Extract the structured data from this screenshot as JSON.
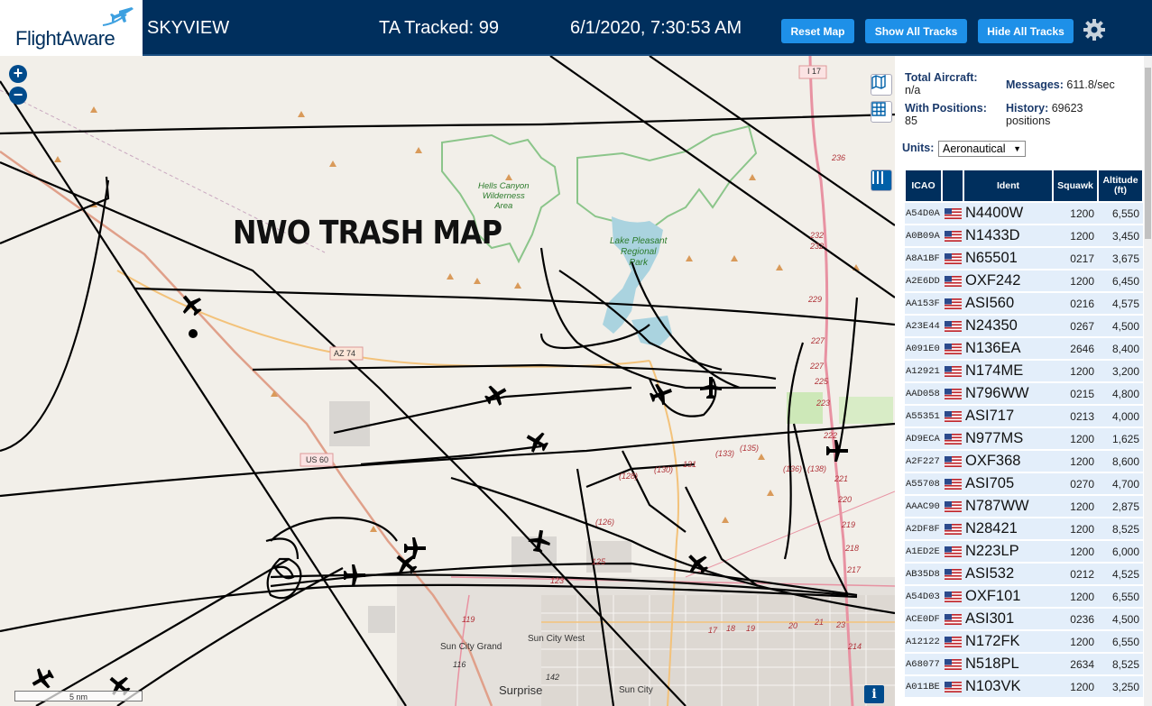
{
  "header": {
    "logo": "FlightAware",
    "app_name": "SKYVIEW",
    "tracked": "TA Tracked: 99",
    "datetime": "6/1/2020, 7:30:53 AM",
    "reset_label": "Reset Map",
    "show_label": "Show All Tracks",
    "hide_label": "Hide All Tracks",
    "settings_icon": "gear-icon"
  },
  "map": {
    "overlay_title": "NWO TRASH MAP",
    "scale": "5 nm",
    "info": "i",
    "labels": {
      "hells_canyon": [
        "Hells Canyon",
        "Wilderness",
        "Area"
      ],
      "lake_pleasant": [
        "Lake Pleasant",
        "Regional",
        "Park"
      ],
      "i17": "I 17",
      "az74": "AZ 74",
      "us60": "US 60",
      "sun_city_grand": "Sun City Grand",
      "sun_city_west": "Sun City West",
      "surprise": "Surprise",
      "sun_city": "Sun City",
      "r128": "(128)",
      "r130": "(130)",
      "r131": "131",
      "r133": "(133)",
      "r135": "(135)",
      "r136": "(136)",
      "r138": "(138)",
      "r126": "(126)",
      "r125": "125",
      "r123": "123",
      "r119": "119",
      "r116": "116",
      "r142": "142",
      "r236": "236",
      "r232a": "232",
      "r232b": "232",
      "r229": "229",
      "r227a": "227",
      "r227b": "227",
      "r225": "225",
      "r223": "223",
      "r222": "222",
      "r221": "221",
      "r220": "220",
      "r219": "219",
      "r218": "218",
      "r217": "217",
      "r214": "214",
      "r17": "17",
      "r18": "18",
      "r19": "19",
      "r20": "20",
      "r21": "21",
      "r23": "23"
    }
  },
  "stats": {
    "total_label": "Total Aircraft:",
    "total_value": "n/a",
    "messages_label": "Messages:",
    "messages_value": "611.8/sec",
    "positions_label": "With Positions:",
    "positions_value": "85",
    "history_label": "History:",
    "history_value": "69623",
    "history_unit": "positions",
    "units_label": "Units:",
    "units_value": "Aeronautical"
  },
  "table": {
    "headers": {
      "icao": "ICAO",
      "ident": "Ident",
      "squawk": "Squawk",
      "alt1": "Altitude",
      "alt2": "(ft)"
    },
    "rows": [
      {
        "icao": "A54D0A",
        "ident": "N4400W",
        "squawk": "1200",
        "alt": "6,550"
      },
      {
        "icao": "A0B09A",
        "ident": "N1433D",
        "squawk": "1200",
        "alt": "3,450"
      },
      {
        "icao": "A8A1BF",
        "ident": "N65501",
        "squawk": "0217",
        "alt": "3,675"
      },
      {
        "icao": "A2E6DD",
        "ident": "OXF242",
        "squawk": "1200",
        "alt": "6,450"
      },
      {
        "icao": "AA153F",
        "ident": "ASI560",
        "squawk": "0216",
        "alt": "4,575"
      },
      {
        "icao": "A23E44",
        "ident": "N24350",
        "squawk": "0267",
        "alt": "4,500"
      },
      {
        "icao": "A091E0",
        "ident": "N136EA",
        "squawk": "2646",
        "alt": "8,400"
      },
      {
        "icao": "A12921",
        "ident": "N174ME",
        "squawk": "1200",
        "alt": "3,200"
      },
      {
        "icao": "AAD058",
        "ident": "N796WW",
        "squawk": "0215",
        "alt": "4,800"
      },
      {
        "icao": "A55351",
        "ident": "ASI717",
        "squawk": "0213",
        "alt": "4,000"
      },
      {
        "icao": "AD9ECA",
        "ident": "N977MS",
        "squawk": "1200",
        "alt": "1,625"
      },
      {
        "icao": "A2F227",
        "ident": "OXF368",
        "squawk": "1200",
        "alt": "8,600"
      },
      {
        "icao": "A55708",
        "ident": "ASI705",
        "squawk": "0270",
        "alt": "4,700"
      },
      {
        "icao": "AAAC90",
        "ident": "N787WW",
        "squawk": "1200",
        "alt": "2,875"
      },
      {
        "icao": "A2DF8F",
        "ident": "N28421",
        "squawk": "1200",
        "alt": "8,525"
      },
      {
        "icao": "A1ED2E",
        "ident": "N223LP",
        "squawk": "1200",
        "alt": "6,000"
      },
      {
        "icao": "AB35D8",
        "ident": "ASI532",
        "squawk": "0212",
        "alt": "4,525"
      },
      {
        "icao": "A54D03",
        "ident": "OXF101",
        "squawk": "1200",
        "alt": "6,550"
      },
      {
        "icao": "ACE0DF",
        "ident": "ASI301",
        "squawk": "0236",
        "alt": "4,500"
      },
      {
        "icao": "A12122",
        "ident": "N172FK",
        "squawk": "1200",
        "alt": "6,550"
      },
      {
        "icao": "A68077",
        "ident": "N518PL",
        "squawk": "2634",
        "alt": "8,525"
      },
      {
        "icao": "A011BE",
        "ident": "N103VK",
        "squawk": "1200",
        "alt": "3,250"
      }
    ]
  }
}
